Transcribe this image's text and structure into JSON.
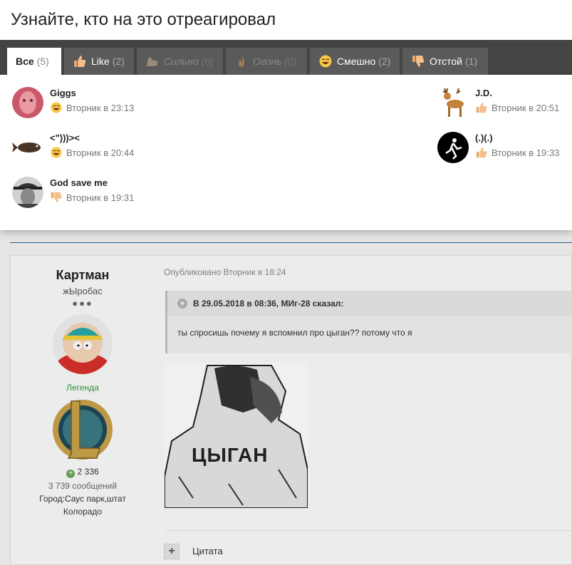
{
  "modal": {
    "title": "Узнайте, кто на это отреагировал",
    "tabs": [
      {
        "label": "Все",
        "count": "(5)",
        "icon": "none",
        "state": "active"
      },
      {
        "label": "Like",
        "count": "(2)",
        "icon": "thumbs-up-icon",
        "state": "normal"
      },
      {
        "label": "Сильно",
        "count": "(0)",
        "icon": "flexed-arm-icon",
        "state": "disabled"
      },
      {
        "label": "Огонь",
        "count": "(0)",
        "icon": "fire-icon",
        "state": "disabled"
      },
      {
        "label": "Смешно",
        "count": "(2)",
        "icon": "laughing-face-icon",
        "state": "normal"
      },
      {
        "label": "Отстой",
        "count": "(1)",
        "icon": "thumbs-down-icon",
        "state": "normal"
      }
    ],
    "reactions": [
      {
        "name": "Giggs",
        "reaction": "laughing-face-icon",
        "time": "Вторник в 23:13"
      },
      {
        "name": "<\")))><",
        "reaction": "laughing-face-icon",
        "time": "Вторник в 20:44"
      },
      {
        "name": "God save me",
        "reaction": "thumbs-down-icon",
        "time": "Вторник в 19:31"
      },
      {
        "name": "J.D.",
        "reaction": "thumbs-up-icon",
        "time": "Вторник в 20:51"
      },
      {
        "name": "(.)(.)",
        "reaction": "thumbs-up-icon",
        "time": "Вторник в 19:33"
      }
    ]
  },
  "post": {
    "author": {
      "name": "Картман",
      "title": "жЫробас",
      "pips": "●●●",
      "rank": "Легенда",
      "reputation": "2 336",
      "posts": "3 739 сообщений",
      "location": "Город:Саус парк,штат Колорадо"
    },
    "published": "Опубликовано Вторник в 18:24",
    "quote_header": "В 29.05.2018 в 08:36, МИг-28 сказал:",
    "quote_text": "ты спросишь почему я вспомнил про цыган?? потому что я",
    "image_caption": "ЦЫГАН",
    "quote_button": "Цитата"
  },
  "colors": {
    "tabbar": "#444444",
    "tab": "#5a5a5a",
    "rank_green": "#2f9a3a",
    "link_blue": "#2a6496"
  }
}
